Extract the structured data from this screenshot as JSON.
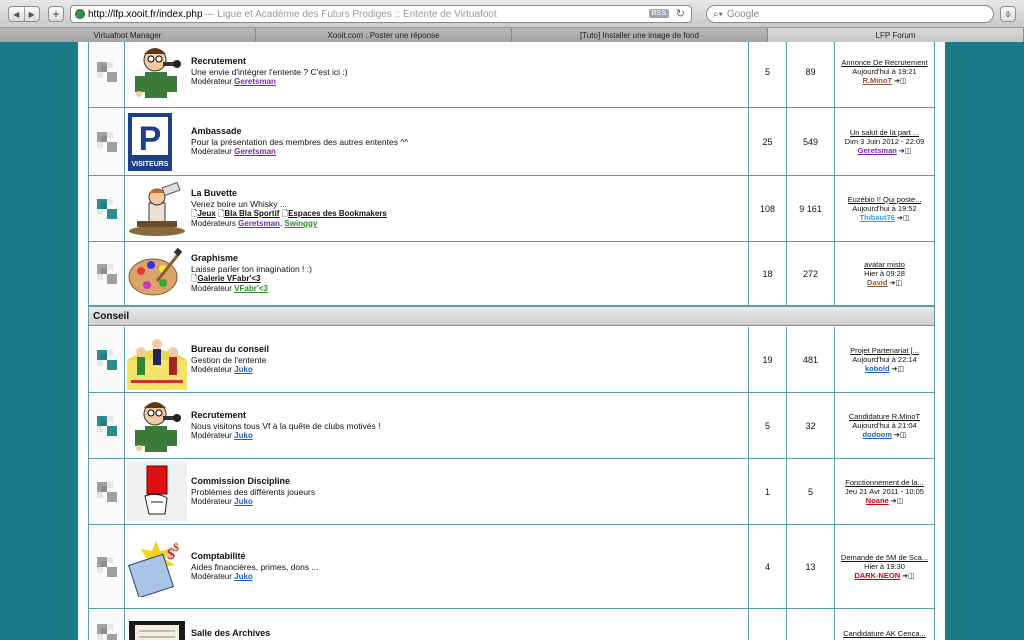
{
  "browser": {
    "url": "http://lfp.xooit.fr/index.php",
    "title_suffix": "— Ligue et Académie des Futurs Prodiges :: Entente de Virtuafoot",
    "rss": "RSS",
    "search_placeholder": "Google",
    "tabs": [
      {
        "label": "Virtuafoot Manager",
        "active": false
      },
      {
        "label": "Xooit.com : Poster une réponse",
        "active": false
      },
      {
        "label": "[Tuto] Installer une image de fond",
        "active": false
      },
      {
        "label": "LFP Forum",
        "active": true
      }
    ]
  },
  "categories": {
    "conseil": "Conseil"
  },
  "forums": [
    {
      "title": "Recrutement",
      "desc": "Une envie d'intégrer l'entente ? C'est ici :)",
      "subforums": [],
      "mod_label": "Modérateur",
      "mods": [
        {
          "name": "Geretsman",
          "color": "purple"
        }
      ],
      "topics": "5",
      "posts": "89",
      "last": {
        "topic": "Annonce De Recrutement",
        "date": "Aujourd'hui à 19:21",
        "user": "R.MinoT",
        "ucolor": "brown"
      },
      "status": "read",
      "icon": "recruit-icon"
    },
    {
      "title": "Ambassade",
      "desc": "Pour la présentation des membres des autres ententes ^^",
      "subforums": [],
      "mod_label": "Modérateur",
      "mods": [
        {
          "name": "Geretsman",
          "color": "purple"
        }
      ],
      "topics": "25",
      "posts": "549",
      "last": {
        "topic": "Un salut de la part ...",
        "date": "Dim 3 Juin 2012 - 22:09",
        "user": "Geretsman",
        "ucolor": "purple"
      },
      "status": "read",
      "icon": "parking-sign-icon"
    },
    {
      "title": "La Buvette",
      "desc": "Venez boire un Whisky ...",
      "subforums": [
        "Jeux",
        "Bla Bla Sportif",
        "Espaces des Bookmakers"
      ],
      "mod_label": "Modérateurs",
      "mods": [
        {
          "name": "Geretsman",
          "color": "purple"
        },
        {
          "name": "Swinggy",
          "color": "green"
        }
      ],
      "topics": "108",
      "posts": "9 161",
      "last": {
        "topic": "Euzébio !! Qui poste...",
        "date": "Aujourd'hui à 19:52",
        "user": "Thibaut76",
        "ucolor": "lblue"
      },
      "status": "new",
      "icon": "drinker-icon"
    },
    {
      "title": "Graphisme",
      "desc": "Laisse parler ton imagination ! :)",
      "subforums": [
        "Galerie VFabr'<3"
      ],
      "mod_label": "Modérateur",
      "mods": [
        {
          "name": "VFabr'<3",
          "color": "green"
        }
      ],
      "topics": "18",
      "posts": "272",
      "last": {
        "topic": "avatar misto",
        "date": "Hier à 09:28",
        "user": "David",
        "ucolor": "brown"
      },
      "status": "read",
      "icon": "palette-icon"
    },
    {
      "title": "Bureau du conseil",
      "desc": "Gestion de l'entente",
      "subforums": [],
      "mod_label": "Modérateur",
      "mods": [
        {
          "name": "Juko",
          "color": "blue"
        }
      ],
      "topics": "19",
      "posts": "481",
      "last": {
        "topic": "Projet Partenariat [...",
        "date": "Aujourd'hui à 22:14",
        "user": "kobold",
        "ucolor": "blue"
      },
      "status": "new",
      "icon": "council-icon"
    },
    {
      "title": "Recrutement",
      "desc": "Nous visitons tous Vf à la quête de clubs motivés !",
      "subforums": [],
      "mod_label": "Modérateur",
      "mods": [
        {
          "name": "Juko",
          "color": "blue"
        }
      ],
      "topics": "5",
      "posts": "32",
      "last": {
        "topic": "Candidature R.MinoT",
        "date": "Aujourd'hui à 21:04",
        "user": "dodoom",
        "ucolor": "blue"
      },
      "status": "new",
      "icon": "recruit-icon"
    },
    {
      "title": "Commission Discipline",
      "desc": "Problèmes des différents joueurs",
      "subforums": [],
      "mod_label": "Modérateur",
      "mods": [
        {
          "name": "Juko",
          "color": "blue"
        }
      ],
      "topics": "1",
      "posts": "5",
      "last": {
        "topic": "Fonctionnement de la...",
        "date": "Jeu 21 Avr 2011 - 10:05",
        "user": "Noane",
        "ucolor": "red"
      },
      "status": "read",
      "icon": "red-card-icon"
    },
    {
      "title": "Comptabilité",
      "desc": "Aides financières, primes, dons ...",
      "subforums": [],
      "mod_label": "Modérateur",
      "mods": [
        {
          "name": "Juko",
          "color": "blue"
        }
      ],
      "topics": "4",
      "posts": "13",
      "last": {
        "topic": "Demande de 5M de Sca...",
        "date": "Hier à 19:30",
        "user": "DARK-NEON",
        "ucolor": "red"
      },
      "status": "read",
      "icon": "calculator-icon"
    },
    {
      "title": "Salle des Archives",
      "desc": "",
      "subforums": [],
      "mod_label": "",
      "mods": [],
      "topics": "",
      "posts": "",
      "last": {
        "topic": "Candidature AK Cenca...",
        "date": "",
        "user": "",
        "ucolor": "blue"
      },
      "status": "read",
      "icon": "archive-icon"
    }
  ],
  "colors": {
    "background": "#1c7b86",
    "border": "#5a9fa8",
    "new_icon": "#2a8f8a",
    "read_icon": "#a0a0a0"
  }
}
